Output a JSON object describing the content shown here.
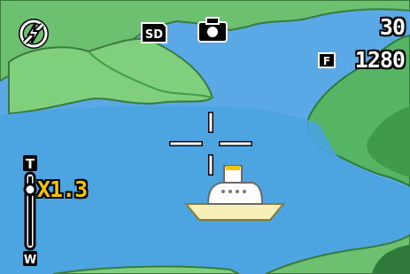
{
  "status_bar": {
    "shots_remaining": "30",
    "image_size": "1280",
    "quality_icon_letter": "F",
    "sd_card_label": "SD"
  },
  "zoom": {
    "value_label": "X1.3",
    "tele_label": "T",
    "wide_label": "W",
    "level_fraction": 0.15
  },
  "icons": {
    "flash": "flash-off-icon",
    "storage": "sd-card-icon",
    "mode": "camera-mode-icon",
    "quality": "fine-quality-icon",
    "focus": "af-target-crosshair"
  },
  "colors": {
    "sky": "#5aa9e6",
    "water": "#4aa3e0",
    "mountain": "#6cc070",
    "mountain_dark": "#3f9a4a",
    "zoom_value": "#f5c400",
    "osd_text": "#ffffff",
    "osd_outline": "#000000"
  }
}
